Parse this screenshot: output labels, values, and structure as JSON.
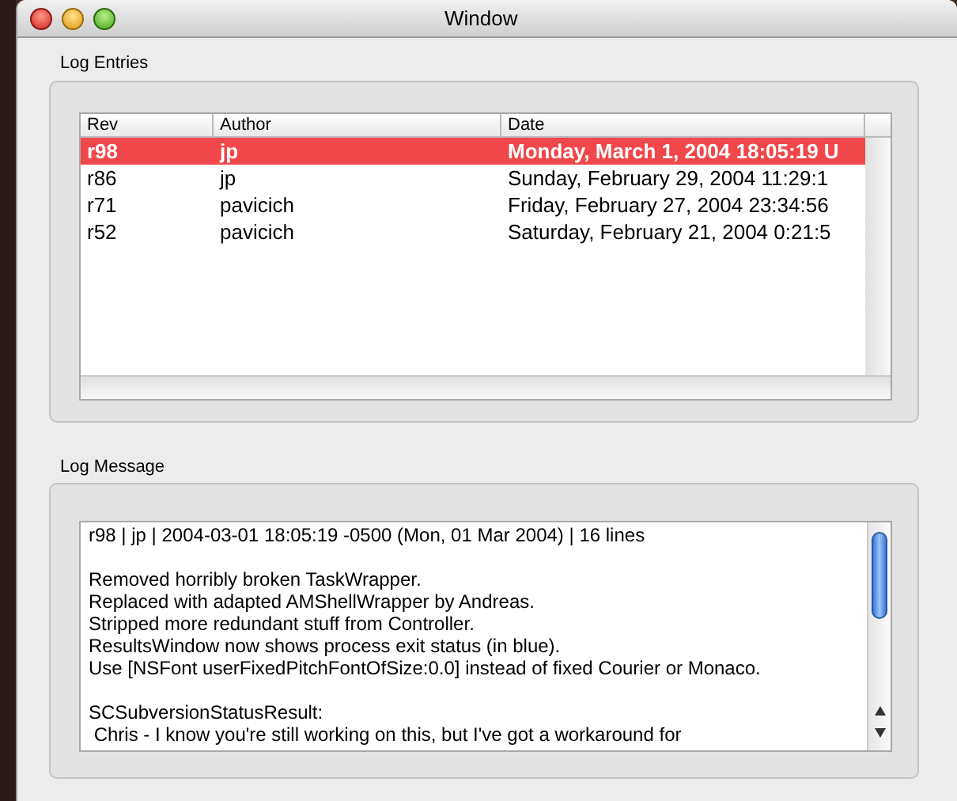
{
  "window": {
    "title": "Window"
  },
  "log_entries": {
    "title": "Log Entries",
    "columns": [
      "Rev",
      "Author",
      "Date"
    ],
    "rows": [
      {
        "cells": [
          "r98",
          "jp",
          "Monday, March 1, 2004 18:05:19 U"
        ],
        "selected": true
      },
      {
        "cells": [
          "r86",
          "jp",
          "Sunday, February 29, 2004 11:29:1"
        ],
        "selected": false
      },
      {
        "cells": [
          "r71",
          "pavicich",
          "Friday, February 27, 2004 23:34:56"
        ],
        "selected": false
      },
      {
        "cells": [
          "r52",
          "pavicich",
          "Saturday, February 21, 2004 0:21:5"
        ],
        "selected": false
      }
    ]
  },
  "log_message": {
    "title": "Log Message",
    "paragraphs": [
      {
        "lines": [
          "r98 | jp | 2004-03-01 18:05:19 -0500 (Mon, 01 Mar 2004) | 16 lines"
        ]
      },
      {
        "lines": [
          "Removed horribly broken TaskWrapper.",
          "Replaced with adapted AMShellWrapper by Andreas.",
          "Stripped more redundant stuff from Controller.",
          "ResultsWindow now shows process exit status (in blue).",
          "Use [NSFont userFixedPitchFontOfSize:0.0] instead of fixed Courier or Monaco."
        ]
      },
      {
        "lines": [
          "SCSubversionStatusResult:",
          " Chris - I know you're still working on this, but I've got a workaround for"
        ]
      }
    ]
  }
}
